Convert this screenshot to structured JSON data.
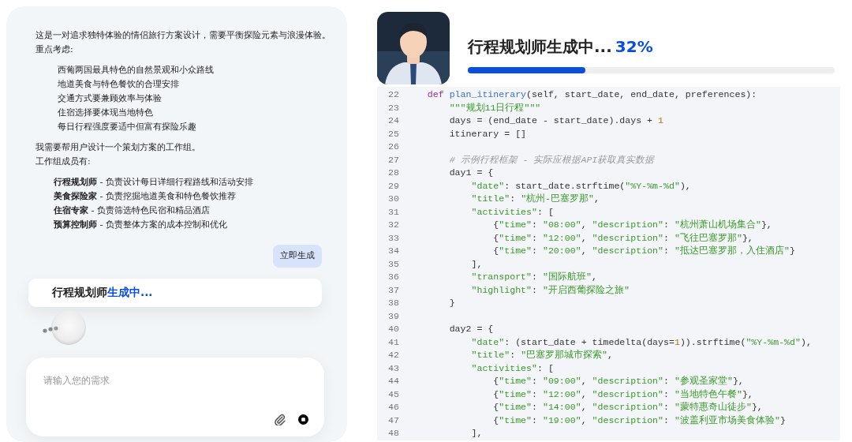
{
  "chat": {
    "intro": [
      "这是一对追求独特体验的情侣旅行方案设计，需要平衡探险元素与浪漫体验。",
      "重点考虑:"
    ],
    "points": [
      "西葡两国最具特色的自然景观和小众路线",
      "地道美食与特色餐饮的合理安排",
      "交通方式要兼顾效率与体验",
      "住宿选择要体现当地特色",
      "每日行程强度要适中但富有探险乐趣"
    ],
    "team_intro": [
      "我需要帮用户设计一个策划方案的工作组。",
      "工作组成员有:"
    ],
    "members": [
      "**行程规划师** - 负责设计每日详细行程路线和活动安排",
      "**美食探险家** - 负责挖掘地道美食和特色餐饮推荐",
      "**住宿专家** - 负责筛选特色民宿和精品酒店",
      "**预算控制师** - 负责整体方案的成本控制和优化"
    ],
    "user_message": "立即生成",
    "status": {
      "agent": "行程规划师",
      "state": "生成中..."
    },
    "input": {
      "placeholder": "请输入您的需求"
    }
  },
  "panel": {
    "title": "行程规划师生成中...",
    "percent": "32%",
    "level": 0.32,
    "code": [
      {
        "no": "22",
        "tokens": [
          {
            "kind": "kw",
            "text": "    def"
          },
          {
            "kind": "fn",
            "text": " plan_itinerary"
          },
          {
            "kind": "plain",
            "text": "(self, start_date, end_date, preferences):"
          }
        ]
      },
      {
        "no": "23",
        "tokens": [
          {
            "kind": "str",
            "text": "        \"\"\"规划11日行程\"\"\""
          }
        ]
      },
      {
        "no": "24",
        "tokens": [
          {
            "kind": "plain",
            "text": "        days = (end_date - start_date).days + "
          },
          {
            "kind": "num",
            "text": "1"
          }
        ]
      },
      {
        "no": "25",
        "tokens": [
          {
            "kind": "plain",
            "text": "        itinerary = []"
          }
        ]
      },
      {
        "no": "26"
      },
      {
        "no": "27",
        "tokens": [
          {
            "kind": "comment",
            "text": "        # 示例行程框架 - 实际应根据API获取真实数据"
          }
        ]
      },
      {
        "no": "28",
        "tokens": [
          {
            "kind": "plain",
            "text": "        day1 = {"
          }
        ]
      },
      {
        "no": "29",
        "tokens": [
          {
            "kind": "str",
            "text": "            \"date\""
          },
          {
            "kind": "plain",
            "text": ": start_date.strftime("
          },
          {
            "kind": "str",
            "text": "\"%Y-%m-%d\""
          },
          {
            "kind": "plain",
            "text": "),"
          }
        ]
      },
      {
        "no": "30",
        "tokens": [
          {
            "kind": "str",
            "text": "            \"title\""
          },
          {
            "kind": "plain",
            "text": ": "
          },
          {
            "kind": "str",
            "text": "\"杭州-巴塞罗那\""
          },
          {
            "kind": "plain",
            "text": ","
          }
        ]
      },
      {
        "no": "31",
        "tokens": [
          {
            "kind": "str",
            "text": "            \"activities\""
          },
          {
            "kind": "plain",
            "text": ": ["
          }
        ]
      },
      {
        "no": "32",
        "tokens": [
          {
            "kind": "plain",
            "text": "                {"
          },
          {
            "kind": "str",
            "text": "\"time\""
          },
          {
            "kind": "plain",
            "text": ": "
          },
          {
            "kind": "str",
            "text": "\"08:00\""
          },
          {
            "kind": "plain",
            "text": ", "
          },
          {
            "kind": "str",
            "text": "\"description\""
          },
          {
            "kind": "plain",
            "text": ": "
          },
          {
            "kind": "str",
            "text": "\"杭州萧山机场集合\""
          },
          {
            "kind": "plain",
            "text": "},"
          }
        ]
      },
      {
        "no": "33",
        "tokens": [
          {
            "kind": "plain",
            "text": "                {"
          },
          {
            "kind": "str",
            "text": "\"time\""
          },
          {
            "kind": "plain",
            "text": ": "
          },
          {
            "kind": "str",
            "text": "\"12:00\""
          },
          {
            "kind": "plain",
            "text": ", "
          },
          {
            "kind": "str",
            "text": "\"description\""
          },
          {
            "kind": "plain",
            "text": ": "
          },
          {
            "kind": "str",
            "text": "\"飞往巴塞罗那\""
          },
          {
            "kind": "plain",
            "text": "},"
          }
        ]
      },
      {
        "no": "34",
        "tokens": [
          {
            "kind": "plain",
            "text": "                {"
          },
          {
            "kind": "str",
            "text": "\"time\""
          },
          {
            "kind": "plain",
            "text": ": "
          },
          {
            "kind": "str",
            "text": "\"20:00\""
          },
          {
            "kind": "plain",
            "text": ", "
          },
          {
            "kind": "str",
            "text": "\"description\""
          },
          {
            "kind": "plain",
            "text": ": "
          },
          {
            "kind": "str",
            "text": "\"抵达巴塞罗那，入住酒店\""
          },
          {
            "kind": "plain",
            "text": "}"
          }
        ]
      },
      {
        "no": "35",
        "tokens": [
          {
            "kind": "plain",
            "text": "            ],"
          }
        ]
      },
      {
        "no": "36",
        "tokens": [
          {
            "kind": "str",
            "text": "            \"transport\""
          },
          {
            "kind": "plain",
            "text": ": "
          },
          {
            "kind": "str",
            "text": "\"国际航班\""
          },
          {
            "kind": "plain",
            "text": ","
          }
        ]
      },
      {
        "no": "37",
        "tokens": [
          {
            "kind": "str",
            "text": "            \"highlight\""
          },
          {
            "kind": "plain",
            "text": ": "
          },
          {
            "kind": "str",
            "text": "\"开启西葡探险之旅\""
          }
        ]
      },
      {
        "no": "38",
        "tokens": [
          {
            "kind": "plain",
            "text": "        }"
          }
        ]
      },
      {
        "no": "39"
      },
      {
        "no": "40",
        "tokens": [
          {
            "kind": "plain",
            "text": "        day2 = {"
          }
        ]
      },
      {
        "no": "41",
        "tokens": [
          {
            "kind": "str",
            "text": "            \"date\""
          },
          {
            "kind": "plain",
            "text": ": (start_date + timedelta(days="
          },
          {
            "kind": "num",
            "text": "1"
          },
          {
            "kind": "plain",
            "text": ")).strftime("
          },
          {
            "kind": "str",
            "text": "\"%Y-%m-%d\""
          },
          {
            "kind": "plain",
            "text": "),"
          }
        ]
      },
      {
        "no": "42",
        "tokens": [
          {
            "kind": "str",
            "text": "            \"title\""
          },
          {
            "kind": "plain",
            "text": ": "
          },
          {
            "kind": "str",
            "text": "\"巴塞罗那城市探索\""
          },
          {
            "kind": "plain",
            "text": ","
          }
        ]
      },
      {
        "no": "43",
        "tokens": [
          {
            "kind": "str",
            "text": "            \"activities\""
          },
          {
            "kind": "plain",
            "text": ": ["
          }
        ]
      },
      {
        "no": "44",
        "tokens": [
          {
            "kind": "plain",
            "text": "                {"
          },
          {
            "kind": "str",
            "text": "\"time\""
          },
          {
            "kind": "plain",
            "text": ": "
          },
          {
            "kind": "str",
            "text": "\"09:00\""
          },
          {
            "kind": "plain",
            "text": ", "
          },
          {
            "kind": "str",
            "text": "\"description\""
          },
          {
            "kind": "plain",
            "text": ": "
          },
          {
            "kind": "str",
            "text": "\"参观圣家堂\""
          },
          {
            "kind": "plain",
            "text": "},"
          }
        ]
      },
      {
        "no": "45",
        "tokens": [
          {
            "kind": "plain",
            "text": "                {"
          },
          {
            "kind": "str",
            "text": "\"time\""
          },
          {
            "kind": "plain",
            "text": ": "
          },
          {
            "kind": "str",
            "text": "\"12:00\""
          },
          {
            "kind": "plain",
            "text": ", "
          },
          {
            "kind": "str",
            "text": "\"description\""
          },
          {
            "kind": "plain",
            "text": ": "
          },
          {
            "kind": "str",
            "text": "\"当地特色午餐\""
          },
          {
            "kind": "plain",
            "text": "},"
          }
        ]
      },
      {
        "no": "46",
        "tokens": [
          {
            "kind": "plain",
            "text": "                {"
          },
          {
            "kind": "str",
            "text": "\"time\""
          },
          {
            "kind": "plain",
            "text": ": "
          },
          {
            "kind": "str",
            "text": "\"14:00\""
          },
          {
            "kind": "plain",
            "text": ", "
          },
          {
            "kind": "str",
            "text": "\"description\""
          },
          {
            "kind": "plain",
            "text": ": "
          },
          {
            "kind": "str",
            "text": "\"蒙特惠奇山徒步\""
          },
          {
            "kind": "plain",
            "text": "},"
          }
        ]
      },
      {
        "no": "47",
        "tokens": [
          {
            "kind": "plain",
            "text": "                {"
          },
          {
            "kind": "str",
            "text": "\"time\""
          },
          {
            "kind": "plain",
            "text": ": "
          },
          {
            "kind": "str",
            "text": "\"19:00\""
          },
          {
            "kind": "plain",
            "text": ", "
          },
          {
            "kind": "str",
            "text": "\"description\""
          },
          {
            "kind": "plain",
            "text": ": "
          },
          {
            "kind": "str",
            "text": "\"波盖利亚市场美食体验\""
          },
          {
            "kind": "plain",
            "text": "}"
          }
        ]
      },
      {
        "no": "48",
        "tokens": [
          {
            "kind": "plain",
            "text": "            ],"
          }
        ]
      }
    ]
  }
}
